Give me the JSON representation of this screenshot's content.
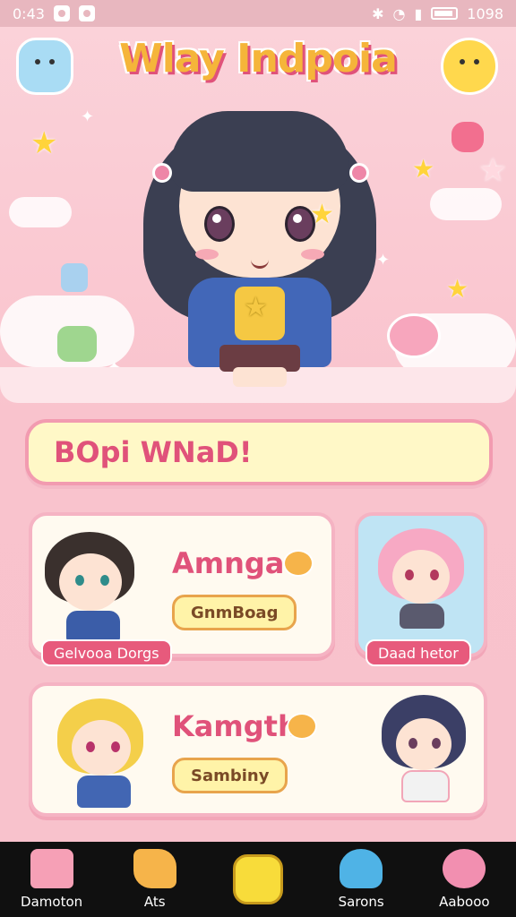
{
  "status_bar": {
    "time": "0:43",
    "right_text": "1098"
  },
  "header": {
    "title": "Wlay Indpoia",
    "left_icon": "cloud-face-icon",
    "right_icon": "sun-face-icon"
  },
  "hero": {
    "character": "main-chibi-girl"
  },
  "banner": {
    "text": "BOpi WNaD!"
  },
  "cards": [
    {
      "name": "Amnga",
      "button": "GnmBoag",
      "tag": "Gelvooa Dorgs"
    },
    {
      "tag": "Daad hetor"
    },
    {
      "name": "Kamgth",
      "button": "Sambiny"
    }
  ],
  "nav": {
    "items": [
      {
        "label": "Damoton",
        "icon": "house-icon"
      },
      {
        "label": "Ats",
        "icon": "carrot-icon"
      },
      {
        "label": "",
        "icon": "pineapple-icon"
      },
      {
        "label": "Sarons",
        "icon": "bird-icon"
      },
      {
        "label": "Aabooo",
        "icon": "cat-icon"
      }
    ]
  },
  "colors": {
    "accent_pink": "#e0527a",
    "title_yellow": "#f5b53a",
    "background": "#fbd3da",
    "nav_bg": "#101010"
  }
}
